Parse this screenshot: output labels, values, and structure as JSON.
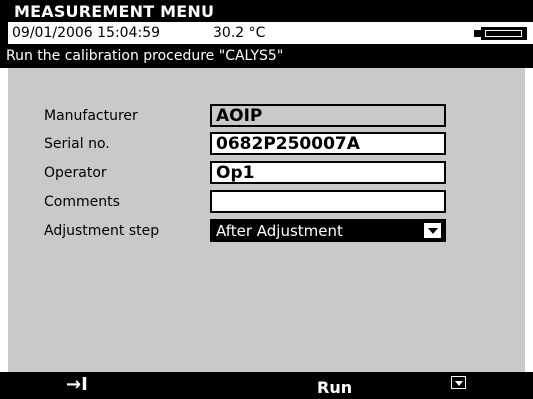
{
  "window": {
    "title": "MEASUREMENT MENU"
  },
  "status": {
    "datetime": "09/01/2006 15:04:59",
    "temperature": "30.2 °C",
    "battery_icon": "battery-icon"
  },
  "procedure": {
    "heading": "Run the calibration procedure \"CALYS5\""
  },
  "form": {
    "manufacturer": {
      "label": "Manufacturer",
      "value": "AOIP"
    },
    "serial": {
      "label": "Serial no.",
      "value": "0682P250007A"
    },
    "operator": {
      "label": "Operator",
      "value": "Op1"
    },
    "comments": {
      "label": "Comments",
      "value": ""
    },
    "adjustment": {
      "label": "Adjustment step",
      "value": "After Adjustment"
    }
  },
  "softkeys": {
    "tab_icon": "→I",
    "run_label": "Run",
    "dropdown_icon": "dropdown-icon"
  },
  "colors": {
    "bar": "#000000",
    "panel": "#c9c9c9",
    "field": "#ffffff"
  }
}
